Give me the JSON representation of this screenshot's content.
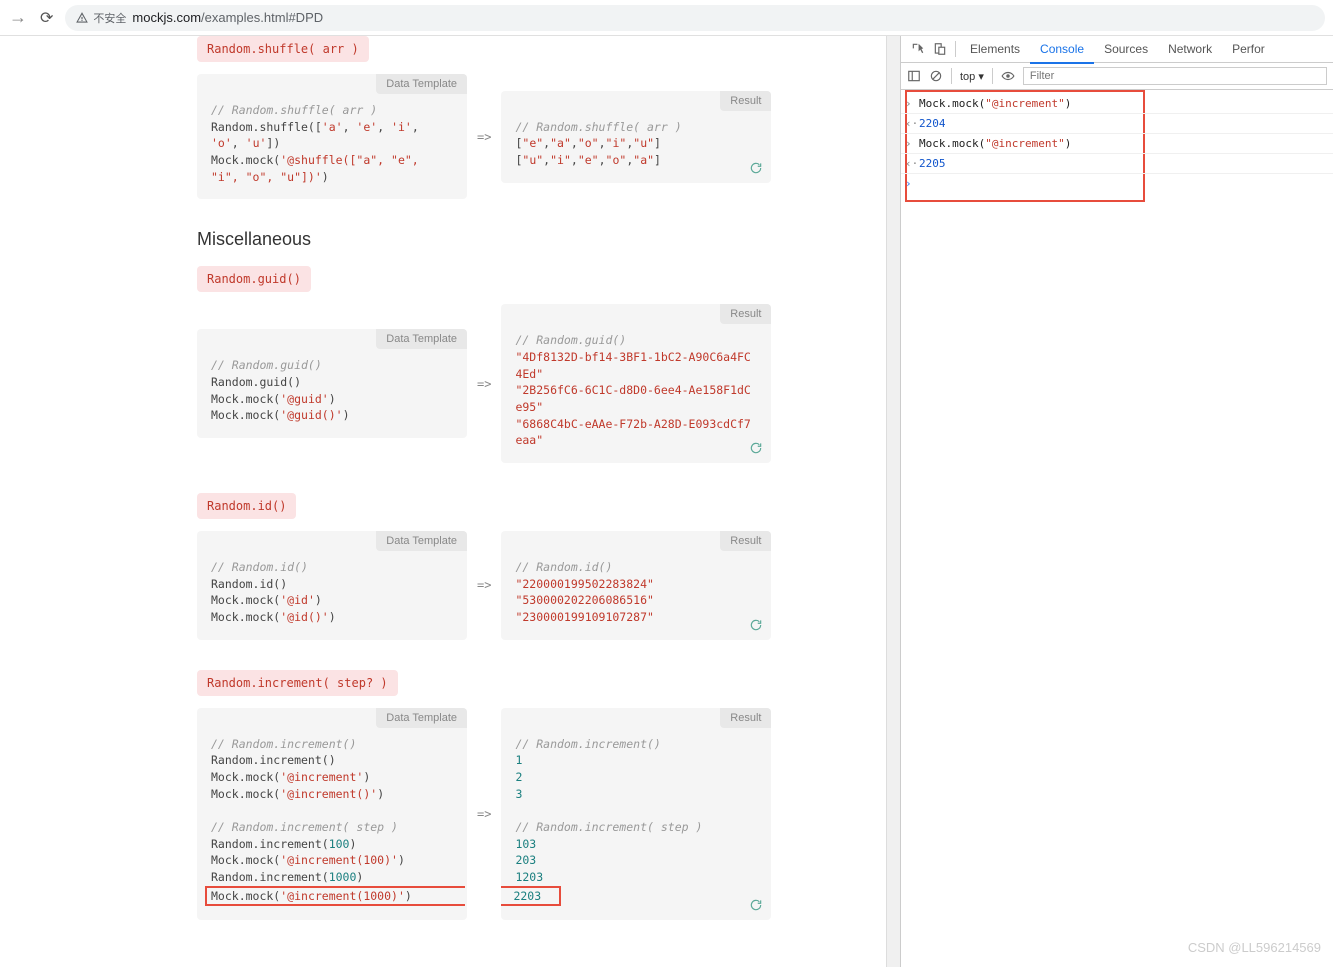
{
  "browser": {
    "insecure_label": "不安全",
    "url_domain": "mockjs.com",
    "url_path": "/examples.html#DPD"
  },
  "labels": {
    "data_template": "Data Template",
    "result": "Result",
    "arrow": "=>"
  },
  "sections": {
    "shuffle": {
      "tag": "Random.shuffle( arr )",
      "template_comment": "// Random.shuffle( arr )",
      "template_lines": [
        "Random.shuffle(['a', 'e', 'i', 'o', 'u'])",
        "Mock.mock('@shuffle([\"a\", \"e\", \"i\", \"o\", \"u\"])')"
      ],
      "result_comment": "// Random.shuffle( arr )",
      "result_lines": [
        "[\"e\",\"a\",\"o\",\"i\",\"u\"]",
        "[\"u\",\"i\",\"e\",\"o\",\"a\"]"
      ]
    },
    "misc_title": "Miscellaneous",
    "guid": {
      "tag": "Random.guid()",
      "template_comment": "// Random.guid()",
      "template_lines": [
        "Random.guid()",
        "Mock.mock('@guid')",
        "Mock.mock('@guid()')"
      ],
      "result_comment": "// Random.guid()",
      "result_lines": [
        "\"4Df8132D-bf14-3BF1-1bC2-A90C6a4FC4Ed\"",
        "\"2B256fC6-6C1C-d8D0-6ee4-Ae158F1dCe95\"",
        "\"6868C4bC-eAAe-F72b-A28D-E093cdCf7eaa\""
      ]
    },
    "id": {
      "tag": "Random.id()",
      "template_comment": "// Random.id()",
      "template_lines": [
        "Random.id()",
        "Mock.mock('@id')",
        "Mock.mock('@id()')"
      ],
      "result_comment": "// Random.id()",
      "result_lines": [
        "\"220000199502283824\"",
        "\"530000202206086516\"",
        "\"230000199109107287\""
      ]
    },
    "increment": {
      "tag": "Random.increment( step? )",
      "template_comment1": "// Random.increment()",
      "template_lines1": [
        "Random.increment()",
        "Mock.mock('@increment')",
        "Mock.mock('@increment()')"
      ],
      "template_comment2": "// Random.increment( step )",
      "template_lines2": [
        "Random.increment(100)",
        "Mock.mock('@increment(100)')",
        "Random.increment(1000)",
        "Mock.mock('@increment(1000)')"
      ],
      "result_comment1": "// Random.increment()",
      "result_lines1": [
        "1",
        "2",
        "3"
      ],
      "result_comment2": "// Random.increment( step )",
      "result_lines2": [
        "103",
        "203",
        "1203",
        "2203"
      ]
    }
  },
  "devtools": {
    "tabs": [
      "Elements",
      "Console",
      "Sources",
      "Network",
      "Perfor"
    ],
    "active_tab": "Console",
    "top_label": "top",
    "filter_placeholder": "Filter",
    "console": [
      {
        "type": "input",
        "call": "Mock.mock(",
        "arg": "\"@increment\"",
        "close": ")"
      },
      {
        "type": "output",
        "value": "2204"
      },
      {
        "type": "input",
        "call": "Mock.mock(",
        "arg": "\"@increment\"",
        "close": ")"
      },
      {
        "type": "output",
        "value": "2205"
      }
    ]
  },
  "watermark": "CSDN @LL596214569"
}
